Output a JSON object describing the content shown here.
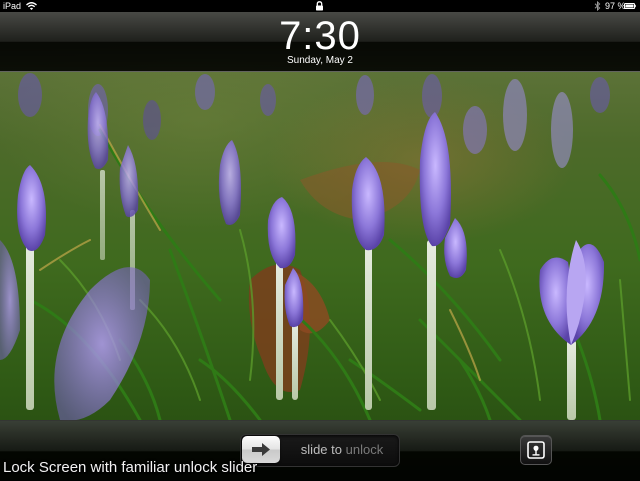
{
  "status_bar": {
    "carrier": "iPad",
    "battery_percent": "97 %",
    "icons": [
      "wifi-icon",
      "lock-icon",
      "bluetooth-icon",
      "battery-icon"
    ]
  },
  "clock": {
    "time": "7:30",
    "date": "Sunday, May 2"
  },
  "slider": {
    "label_slide": "slide ",
    "label_to": "to",
    "label_unlock": " unlock",
    "knob_icon": "arrow-right-icon"
  },
  "photo_frame": {
    "icon": "picture-frame-icon"
  },
  "caption": {
    "text": "Lock Screen with familiar unlock slider"
  },
  "colors": {
    "wallpaper_grass": "#3f6a1e",
    "crocus_purple": "#8a7ad8",
    "bar_black": "#000000",
    "text_white": "#ffffff"
  }
}
